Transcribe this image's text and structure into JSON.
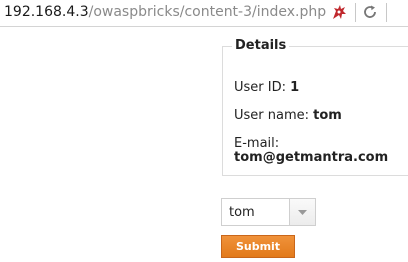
{
  "browser": {
    "url_host": "192.168.4.3",
    "url_path": "/owaspbricks/content-3/index.php"
  },
  "details": {
    "legend": "Details",
    "user_id_label": "User ID:",
    "user_id_value": "1",
    "user_name_label": "User name:",
    "user_name_value": "tom",
    "email_label": "E-mail:",
    "email_value": "tom@getmantra.com"
  },
  "form": {
    "selected_user": "tom",
    "submit_label": "Submit"
  },
  "icons": {
    "addon": "bug-icon",
    "reload": "reload-icon",
    "dropdown": "chevron-down-icon"
  },
  "colors": {
    "submit_bg": "#e8832a",
    "url_path": "#8a8a8a",
    "addon_icon": "#c0282d"
  }
}
